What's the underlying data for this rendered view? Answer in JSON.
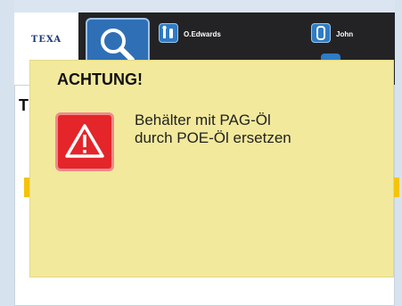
{
  "header": {
    "logo_text": "TEXA",
    "users": [
      {
        "name": "O.Edwards",
        "icon": "mechanic-icon"
      },
      {
        "name": "John",
        "icon": "person-icon"
      }
    ]
  },
  "content": {
    "title": "T"
  },
  "dialog": {
    "title": "ACHTUNG!",
    "message_line1": "Behälter mit PAG-Öl",
    "message_line2": "durch POE-Öl ersetzen",
    "icon": "warning-triangle-icon"
  },
  "colors": {
    "header_bg": "#232325",
    "accent_blue": "#2f6fb6",
    "dialog_bg": "#f2e99c",
    "warning_red": "#e4252a"
  }
}
